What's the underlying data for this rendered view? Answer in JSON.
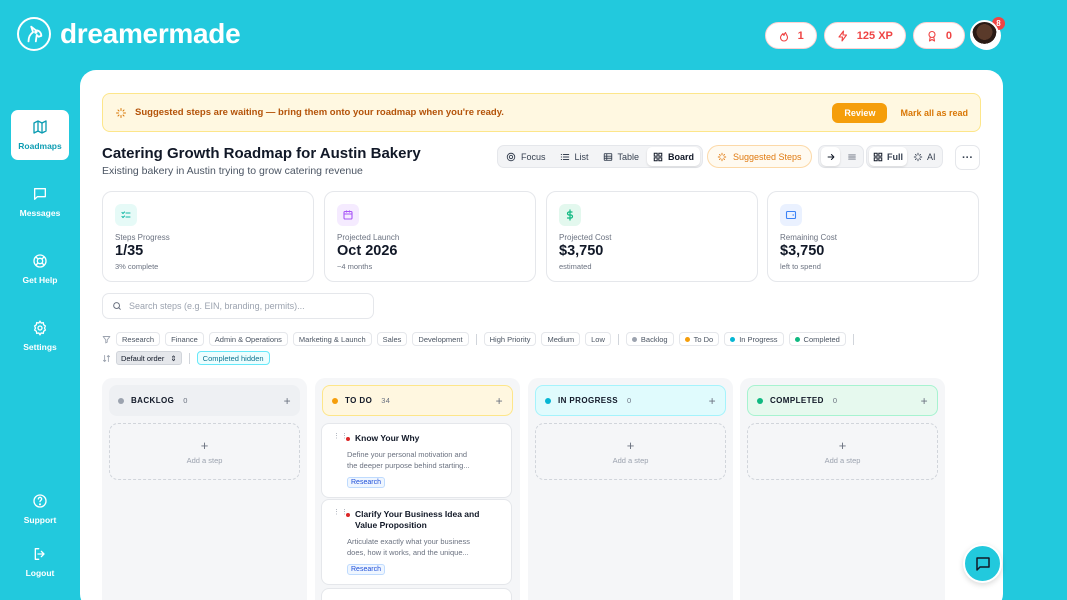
{
  "brand": {
    "name": "dreamermade"
  },
  "header": {
    "streak": "1",
    "xp": "125 XP",
    "awards": "0",
    "notifications_count": "8"
  },
  "sidebar": {
    "items": [
      {
        "label": "Roadmaps",
        "icon": "map-icon",
        "active": true
      },
      {
        "label": "Messages",
        "icon": "message-icon"
      },
      {
        "label": "Get Help",
        "icon": "lifebuoy-icon"
      },
      {
        "label": "Settings",
        "icon": "gear-icon"
      }
    ],
    "bottom": [
      {
        "label": "Support",
        "icon": "help-circle-icon"
      },
      {
        "label": "Logout",
        "icon": "logout-icon"
      }
    ]
  },
  "banner": {
    "text": "Suggested steps are waiting — bring them onto your roadmap when you're ready.",
    "review_label": "Review",
    "mark_read_label": "Mark all as read"
  },
  "page": {
    "title": "Catering Growth Roadmap for Austin Bakery",
    "subtitle": "Existing bakery in Austin trying to grow catering revenue"
  },
  "views": {
    "focus": "Focus",
    "list": "List",
    "table": "Table",
    "board": "Board",
    "active": "Board",
    "suggested": "Suggested Steps",
    "full": "Full",
    "ai": "AI",
    "more": "···"
  },
  "stats": [
    {
      "label": "Steps Progress",
      "value": "1/35",
      "sub": "3% complete",
      "color": "#14b8a6"
    },
    {
      "label": "Projected Launch",
      "value": "Oct 2026",
      "sub": "~4 months",
      "color": "#a855f7"
    },
    {
      "label": "Projected Cost",
      "value": "$3,750",
      "sub": "estimated",
      "color": "#10b981"
    },
    {
      "label": "Remaining Cost",
      "value": "$3,750",
      "sub": "left to spend",
      "color": "#3b82f6"
    }
  ],
  "search": {
    "placeholder": "Search steps (e.g. EIN, branding, permits)..."
  },
  "filters": {
    "categories": [
      "Research",
      "Finance",
      "Admin & Operations",
      "Marketing & Launch",
      "Sales",
      "Development"
    ],
    "priorities": [
      "High Priority",
      "Medium",
      "Low"
    ],
    "statuses": [
      {
        "label": "Backlog",
        "color": "#9ca3af"
      },
      {
        "label": "To Do",
        "color": "#f59e0b"
      },
      {
        "label": "In Progress",
        "color": "#06b6d4"
      },
      {
        "label": "Completed",
        "color": "#10b981"
      }
    ],
    "sort": "Default order",
    "completed_hidden": "Completed hidden"
  },
  "board": {
    "add_step_label": "Add a step",
    "columns": [
      {
        "title": "BACKLOG",
        "count": "0",
        "color": "#9ca3af",
        "bg": "#eef0f3"
      },
      {
        "title": "TO DO",
        "count": "34",
        "color": "#f59e0b",
        "bg": "#fff7e0"
      },
      {
        "title": "IN PROGRESS",
        "count": "0",
        "color": "#06b6d4",
        "bg": "#e0fbfd"
      },
      {
        "title": "COMPLETED",
        "count": "0",
        "color": "#10b981",
        "bg": "#e6f9ee"
      }
    ],
    "todo_cards": [
      {
        "title": "Know Your Why",
        "desc1": "Define your personal motivation and",
        "desc2": "the deeper purpose behind starting...",
        "tag": "Research"
      },
      {
        "title": "Clarify Your Business Idea and",
        "title2": "Value Proposition",
        "desc1": "Articulate exactly what your business",
        "desc2": "does, how it works, and the unique...",
        "tag": "Research"
      }
    ]
  }
}
